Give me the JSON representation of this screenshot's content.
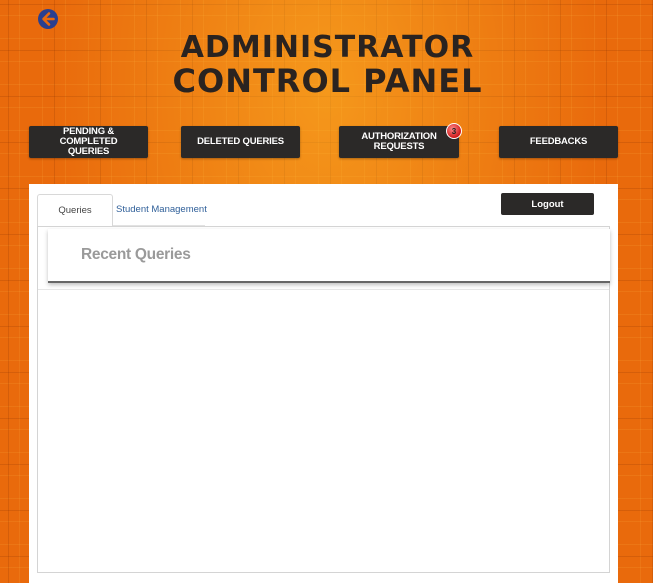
{
  "header": {
    "back_icon": "arrow-left-circle-icon",
    "title_line1": "ADMINISTRATOR",
    "title_line2": "CONTROL PANEL"
  },
  "nav": {
    "pending": "PENDING & COMPLETED\nQUERIES",
    "deleted": "DELETED QUERIES",
    "authorization": "AUTHORIZATION\nREQUESTS",
    "authorization_badge": "3",
    "feedbacks": "FEEDBACKS"
  },
  "tabs": {
    "queries": "Queries",
    "student_management": "Student Management"
  },
  "logout_label": "Logout",
  "main": {
    "card_title": "Recent Queries"
  },
  "colors": {
    "background": "#e96a0c",
    "button": "#2b2928",
    "back_icon": "#2a3f8f",
    "badge": "#d01b1b",
    "link": "#2f5f99"
  }
}
